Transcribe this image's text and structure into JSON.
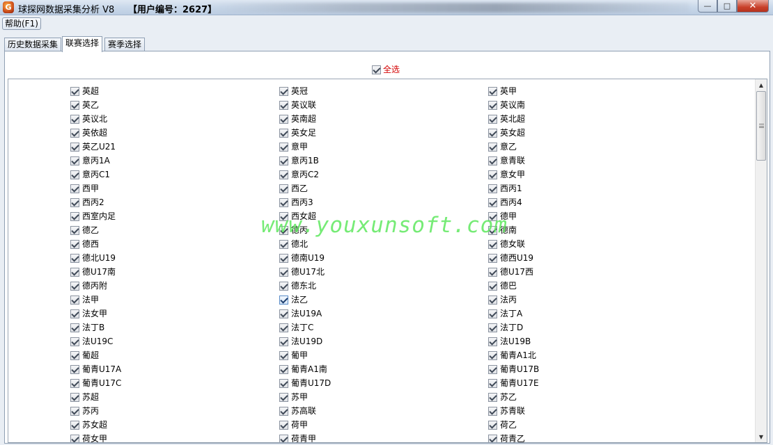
{
  "window": {
    "title": "球探网数据采集分析 V8",
    "user_label": "【用户编号：2627】",
    "minimize": "—",
    "maximize": "□",
    "close": "✕",
    "app_icon": "G"
  },
  "menu": {
    "help": "帮助(F1)"
  },
  "tabs": [
    {
      "label": "历史数据采集",
      "active": false
    },
    {
      "label": "联赛选择",
      "active": true
    },
    {
      "label": "赛季选择",
      "active": false
    }
  ],
  "select_all": {
    "label": "全选",
    "checked": true
  },
  "watermark": "www.youxunsoft.com",
  "leagues": [
    [
      "英超",
      "英冠",
      "英甲"
    ],
    [
      "英乙",
      "英议联",
      "英议南"
    ],
    [
      "英议北",
      "英南超",
      "英北超"
    ],
    [
      "英依超",
      "英女足",
      "英女超"
    ],
    [
      "英乙U21",
      "意甲",
      "意乙"
    ],
    [
      "意丙1A",
      "意丙1B",
      "意青联"
    ],
    [
      "意丙C1",
      "意丙C2",
      "意女甲"
    ],
    [
      "西甲",
      "西乙",
      "西丙1"
    ],
    [
      "西丙2",
      "西丙3",
      "西丙4"
    ],
    [
      "西室内足",
      "西女超",
      "德甲"
    ],
    [
      "德乙",
      "德丙",
      "德南"
    ],
    [
      "德西",
      "德北",
      "德女联"
    ],
    [
      "德北U19",
      "德南U19",
      "德西U19"
    ],
    [
      "德U17南",
      "德U17北",
      "德U17西"
    ],
    [
      "德丙附",
      "德东北",
      "德巴"
    ],
    [
      "法甲",
      "法乙",
      "法丙"
    ],
    [
      "法女甲",
      "法U19A",
      "法丁A"
    ],
    [
      "法丁B",
      "法丁C",
      "法丁D"
    ],
    [
      "法U19C",
      "法U19D",
      "法U19B"
    ],
    [
      "葡超",
      "葡甲",
      "葡青A1北"
    ],
    [
      "葡青U17A",
      "葡青A1南",
      "葡青U17B"
    ],
    [
      "葡青U17C",
      "葡青U17D",
      "葡青U17E"
    ],
    [
      "苏超",
      "苏甲",
      "苏乙"
    ],
    [
      "苏丙",
      "苏高联",
      "苏青联"
    ],
    [
      "苏女超",
      "荷甲",
      "荷乙"
    ],
    [
      "荷女甲",
      "荷青甲",
      "荷青乙"
    ]
  ]
}
